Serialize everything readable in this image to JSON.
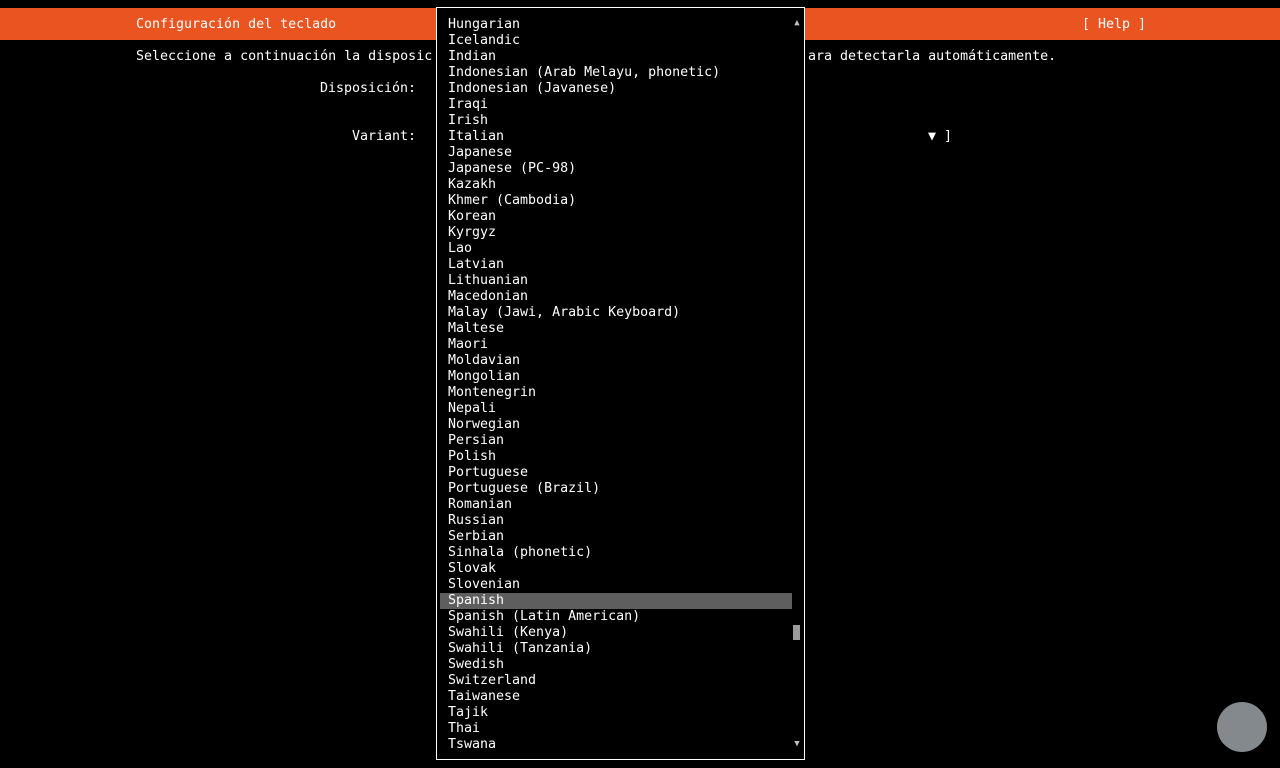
{
  "header": {
    "title": "Configuración del teclado",
    "help": "[ Help ]"
  },
  "instruction": {
    "start": "Seleccione a continuación la disposic",
    "end": "ara detectarla automáticamente."
  },
  "fields": {
    "layout_label": "Disposición:",
    "variant_label": "Variant:",
    "variant_arrow": "▼ ]"
  },
  "dropdown": {
    "scroll_up": "▲",
    "scroll_down": "▼",
    "selected": "Spanish",
    "items": [
      "Hungarian",
      "Icelandic",
      "Indian",
      "Indonesian (Arab Melayu, phonetic)",
      "Indonesian (Javanese)",
      "Iraqi",
      "Irish",
      "Italian",
      "Japanese",
      "Japanese (PC-98)",
      "Kazakh",
      "Khmer (Cambodia)",
      "Korean",
      "Kyrgyz",
      "Lao",
      "Latvian",
      "Lithuanian",
      "Macedonian",
      "Malay (Jawi, Arabic Keyboard)",
      "Maltese",
      "Maori",
      "Moldavian",
      "Mongolian",
      "Montenegrin",
      "Nepali",
      "Norwegian",
      "Persian",
      "Polish",
      "Portuguese",
      "Portuguese (Brazil)",
      "Romanian",
      "Russian",
      "Serbian",
      "Sinhala (phonetic)",
      "Slovak",
      "Slovenian",
      "Spanish",
      "Spanish (Latin American)",
      "Swahili (Kenya)",
      "Swahili (Tanzania)",
      "Swedish",
      "Switzerland",
      "Taiwanese",
      "Tajik",
      "Thai",
      "Tswana"
    ]
  },
  "colors": {
    "header_bg": "#e95420",
    "background": "#000000",
    "text": "#ffffff",
    "selection_bg": "#5e5e5e"
  }
}
